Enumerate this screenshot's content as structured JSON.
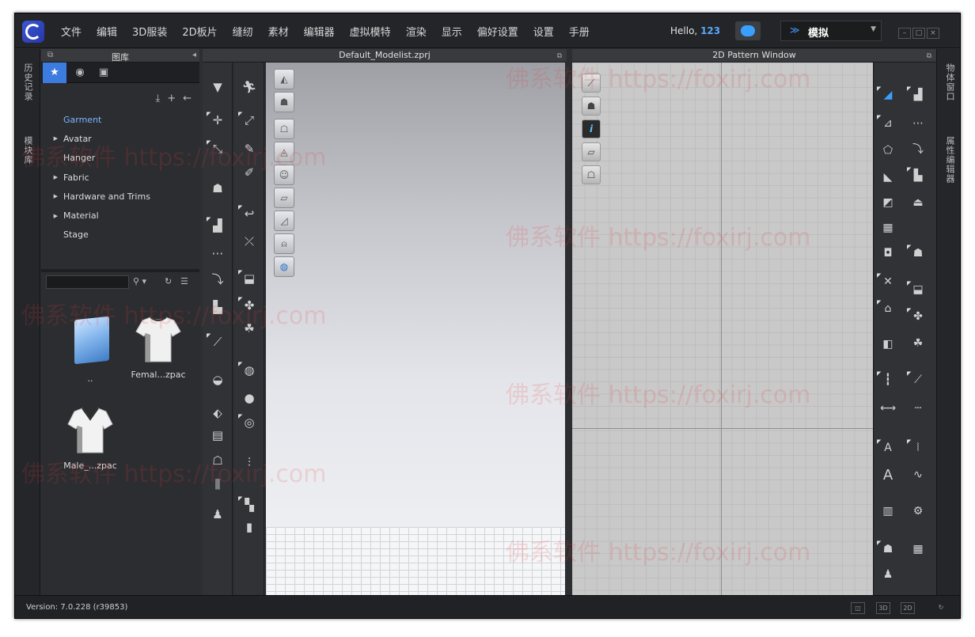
{
  "menubar": {
    "items": [
      "文件",
      "编辑",
      "3D服装",
      "2D板片",
      "缝纫",
      "素材",
      "编辑器",
      "虚拟模特",
      "渲染",
      "显示",
      "偏好设置",
      "设置",
      "手册"
    ],
    "hello_label": "Hello,",
    "user": "123",
    "mode": "模拟"
  },
  "left_tabs": [
    "历史记录",
    "模块库"
  ],
  "right_tabs": [
    "物体窗口",
    "属性编辑器"
  ],
  "library": {
    "title": "图库",
    "tree": [
      {
        "label": "Garment",
        "expandable": false,
        "selected": true
      },
      {
        "label": "Avatar",
        "expandable": true
      },
      {
        "label": "Hanger",
        "expandable": false
      },
      {
        "label": "Fabric",
        "expandable": true
      },
      {
        "label": "Hardware and Trims",
        "expandable": true
      },
      {
        "label": "Material",
        "expandable": true
      },
      {
        "label": "Stage",
        "expandable": false
      }
    ],
    "search_placeholder": "",
    "files": [
      {
        "label": "..",
        "type": "folder"
      },
      {
        "label": "Femal...zpac",
        "type": "tshirt"
      },
      {
        "label": "Male_...zpac",
        "type": "vneck"
      }
    ]
  },
  "window3d": {
    "title": "Default_Modelist.zprj"
  },
  "window2d": {
    "title": "2D Pattern Window"
  },
  "status": {
    "version": "Version: 7.0.228 (r39853)",
    "view_buttons": [
      "3D",
      "2D"
    ]
  },
  "watermark": "佛系软件 https://foxirj.com",
  "colors": {
    "accent": "#3c7be0",
    "user": "#58a8ff",
    "tree_selected": "#7fb4ff",
    "background": "#2c2e31"
  }
}
